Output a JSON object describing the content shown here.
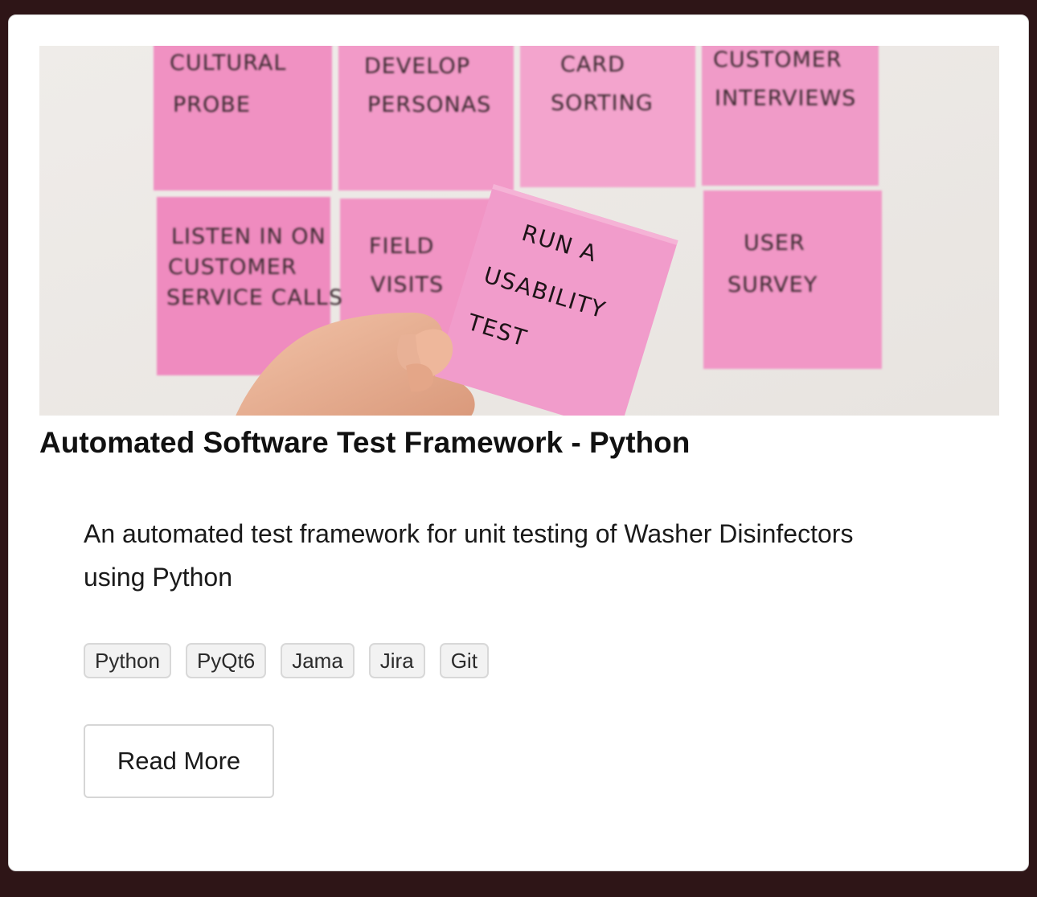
{
  "card": {
    "image": {
      "notes": [
        [
          "CULTURAL",
          "PROBE"
        ],
        [
          "DEVELOP",
          "PERSONAS"
        ],
        [
          "CARD",
          "SORTING"
        ],
        [
          "CUSTOMER",
          "INTERVIEWS"
        ],
        [
          "LISTEN IN ON",
          "CUSTOMER",
          "SERVICE CALLS"
        ],
        [
          "FIELD",
          "VISITS"
        ],
        [
          "USER",
          "SURVEY"
        ]
      ],
      "held_note": [
        "RUN A",
        "USABILITY",
        "TEST"
      ],
      "note_color": "#f18fc3"
    },
    "title": "Automated Software Test Framework - Python",
    "description": "An automated test framework for unit testing of Washer Disinfectors using Python",
    "tags": [
      "Python",
      "PyQt6",
      "Jama",
      "Jira",
      "Git"
    ],
    "button_label": "Read More"
  },
  "colors": {
    "page_background": "#2e1517",
    "card_background": "#ffffff",
    "tag_background": "#f2f2f2"
  }
}
